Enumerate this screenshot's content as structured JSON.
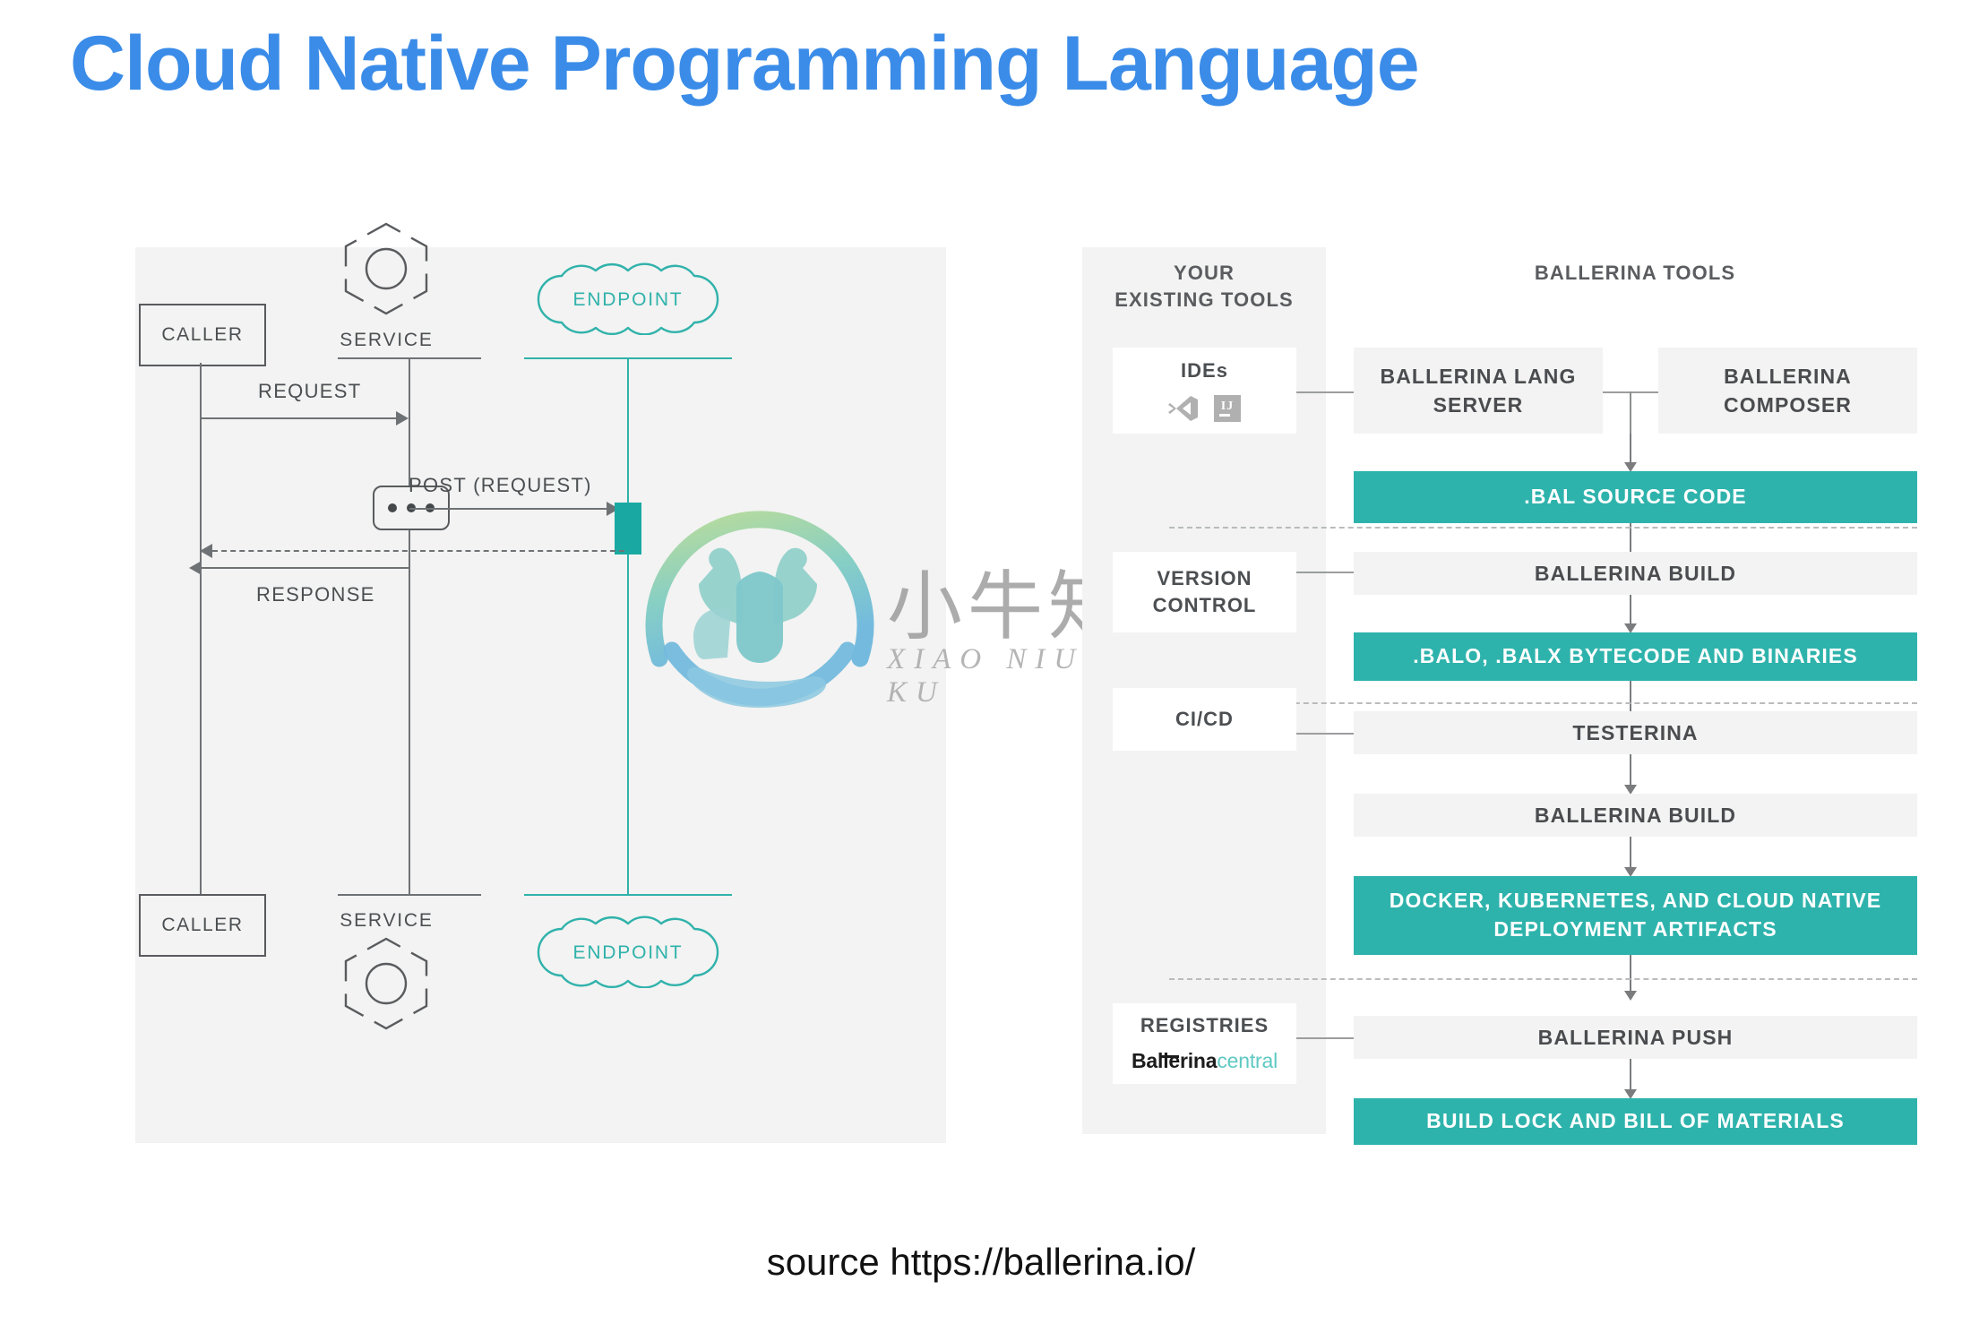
{
  "title": "Cloud Native Programming Language",
  "source": "source https://ballerina.io/",
  "colors": {
    "title_blue": "#3b8ce8",
    "teal": "#2eb3ac",
    "panel_gray": "#f2f3f2",
    "line_gray": "#6f7275",
    "text_gray": "#4c4f52"
  },
  "sequence_diagram": {
    "participants": [
      {
        "name": "caller-top",
        "label": "CALLER",
        "type": "box"
      },
      {
        "name": "service-top",
        "label": "SERVICE",
        "type": "hexagon"
      },
      {
        "name": "endpoint-top",
        "label": "ENDPOINT",
        "type": "cloud"
      },
      {
        "name": "caller-bottom",
        "label": "CALLER",
        "type": "box"
      },
      {
        "name": "service-bottom",
        "label": "SERVICE",
        "type": "hexagon"
      },
      {
        "name": "endpoint-bottom",
        "label": "ENDPOINT",
        "type": "cloud"
      }
    ],
    "messages": [
      {
        "label": "REQUEST",
        "from": "CALLER",
        "to": "SERVICE",
        "style": "solid",
        "direction": "right"
      },
      {
        "label": "POST (REQUEST)",
        "from": "SERVICE",
        "to": "ENDPOINT",
        "style": "solid",
        "direction": "right"
      },
      {
        "label": "",
        "from": "ENDPOINT",
        "to": "SERVICE",
        "style": "dashed",
        "direction": "left"
      },
      {
        "label": "RESPONSE",
        "from": "SERVICE",
        "to": "CALLER",
        "style": "solid",
        "direction": "left"
      }
    ],
    "ellipsis": "•••"
  },
  "pipeline": {
    "left_column_title": "YOUR\nEXISTING TOOLS",
    "right_column_title": "BALLERINA TOOLS",
    "left_boxes": [
      {
        "name": "ides",
        "label": "IDEs",
        "icons": [
          "vscode-icon",
          "intellij-icon"
        ]
      },
      {
        "name": "version-control",
        "label": "VERSION\nCONTROL"
      },
      {
        "name": "ci-cd",
        "label": "CI/CD"
      },
      {
        "name": "registries",
        "label": "REGISTRIES",
        "logo_primary": "Ballerina",
        "logo_secondary": "central"
      }
    ],
    "top_row": [
      {
        "name": "ballerina-lang-server",
        "label": "BALLERINA LANG\nSERVER",
        "style": "gray"
      },
      {
        "name": "ballerina-composer",
        "label": "BALLERINA\nCOMPOSER",
        "style": "gray"
      }
    ],
    "stages": [
      {
        "name": "bal-source-code",
        "label": ".BAL SOURCE CODE",
        "style": "teal"
      },
      {
        "name": "ballerina-build-1",
        "label": "BALLERINA BUILD",
        "style": "gray"
      },
      {
        "name": "balo-balx-bytecode",
        "label": ".BALO, .BALX BYTECODE AND BINARIES",
        "style": "teal"
      },
      {
        "name": "testerina",
        "label": "TESTERINA",
        "style": "gray"
      },
      {
        "name": "ballerina-build-2",
        "label": "BALLERINA BUILD",
        "style": "gray"
      },
      {
        "name": "deployment-artifacts",
        "label": "DOCKER, KUBERNETES, AND CLOUD NATIVE\nDEPLOYMENT ARTIFACTS",
        "style": "teal"
      },
      {
        "name": "ballerina-push",
        "label": "BALLERINA PUSH",
        "style": "gray"
      },
      {
        "name": "build-lock-bom",
        "label": "BUILD LOCK AND BILL OF MATERIALS",
        "style": "teal"
      }
    ]
  },
  "watermark": {
    "cn": "小牛知识库",
    "en": "XIAO NIU ZHI SHI KU"
  }
}
